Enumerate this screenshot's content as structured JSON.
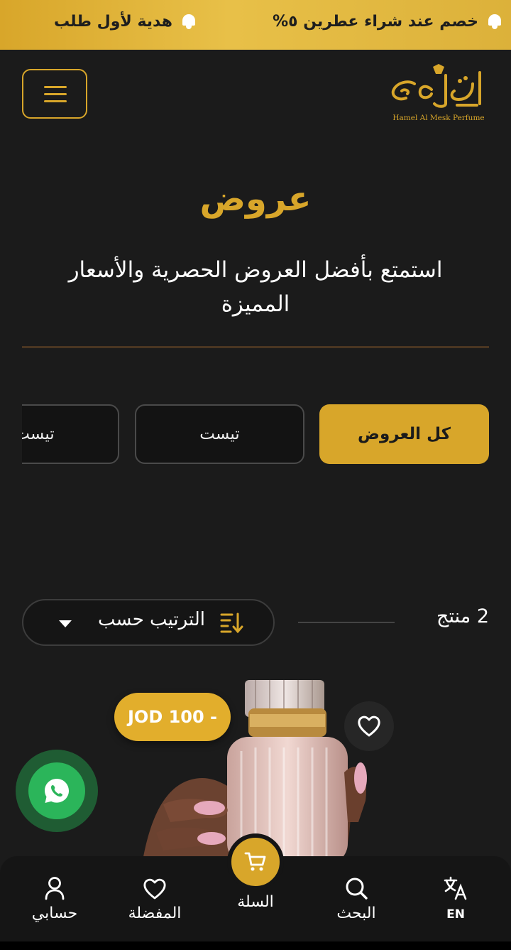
{
  "promo_bar": {
    "items": [
      {
        "text": "خصم عند شراء عطرين ٥%",
        "icon": "bell-icon"
      },
      {
        "text": "هدية لأول طلب",
        "icon": "bell-icon"
      }
    ],
    "background": "#d8a62a"
  },
  "header": {
    "logo_text": "Hamel Al Mesk Perfume",
    "menu_icon": "hamburger-icon"
  },
  "hero": {
    "title": "عروض",
    "subtitle": "استمتع بأفضل العروض الحصرية والأسعار المميزة"
  },
  "categories": [
    {
      "label": "كل العروض",
      "active": true
    },
    {
      "label": "تيست",
      "active": false
    },
    {
      "label": "تيست",
      "active": false
    }
  ],
  "toolbar": {
    "product_count": "2 منتج",
    "sort_label": "الترتيب حسب",
    "sort_icon": "sort-icon"
  },
  "product": {
    "price": "JOD 100 -",
    "favorite_icon": "heart-icon",
    "image": "perfume-bottle-image"
  },
  "whatsapp": {
    "icon": "whatsapp-icon"
  },
  "bottom_nav": {
    "items": [
      {
        "label": "EN",
        "icon": "translate-icon"
      },
      {
        "label": "البحث",
        "icon": "search-icon"
      },
      {
        "label": "السلة",
        "icon": "cart-icon"
      },
      {
        "label": "المفضلة",
        "icon": "heart-icon"
      },
      {
        "label": "حسابي",
        "icon": "user-icon"
      }
    ]
  },
  "colors": {
    "accent": "#d8a62a",
    "background": "#1b1b1b",
    "whatsapp": "#2bb55a"
  }
}
